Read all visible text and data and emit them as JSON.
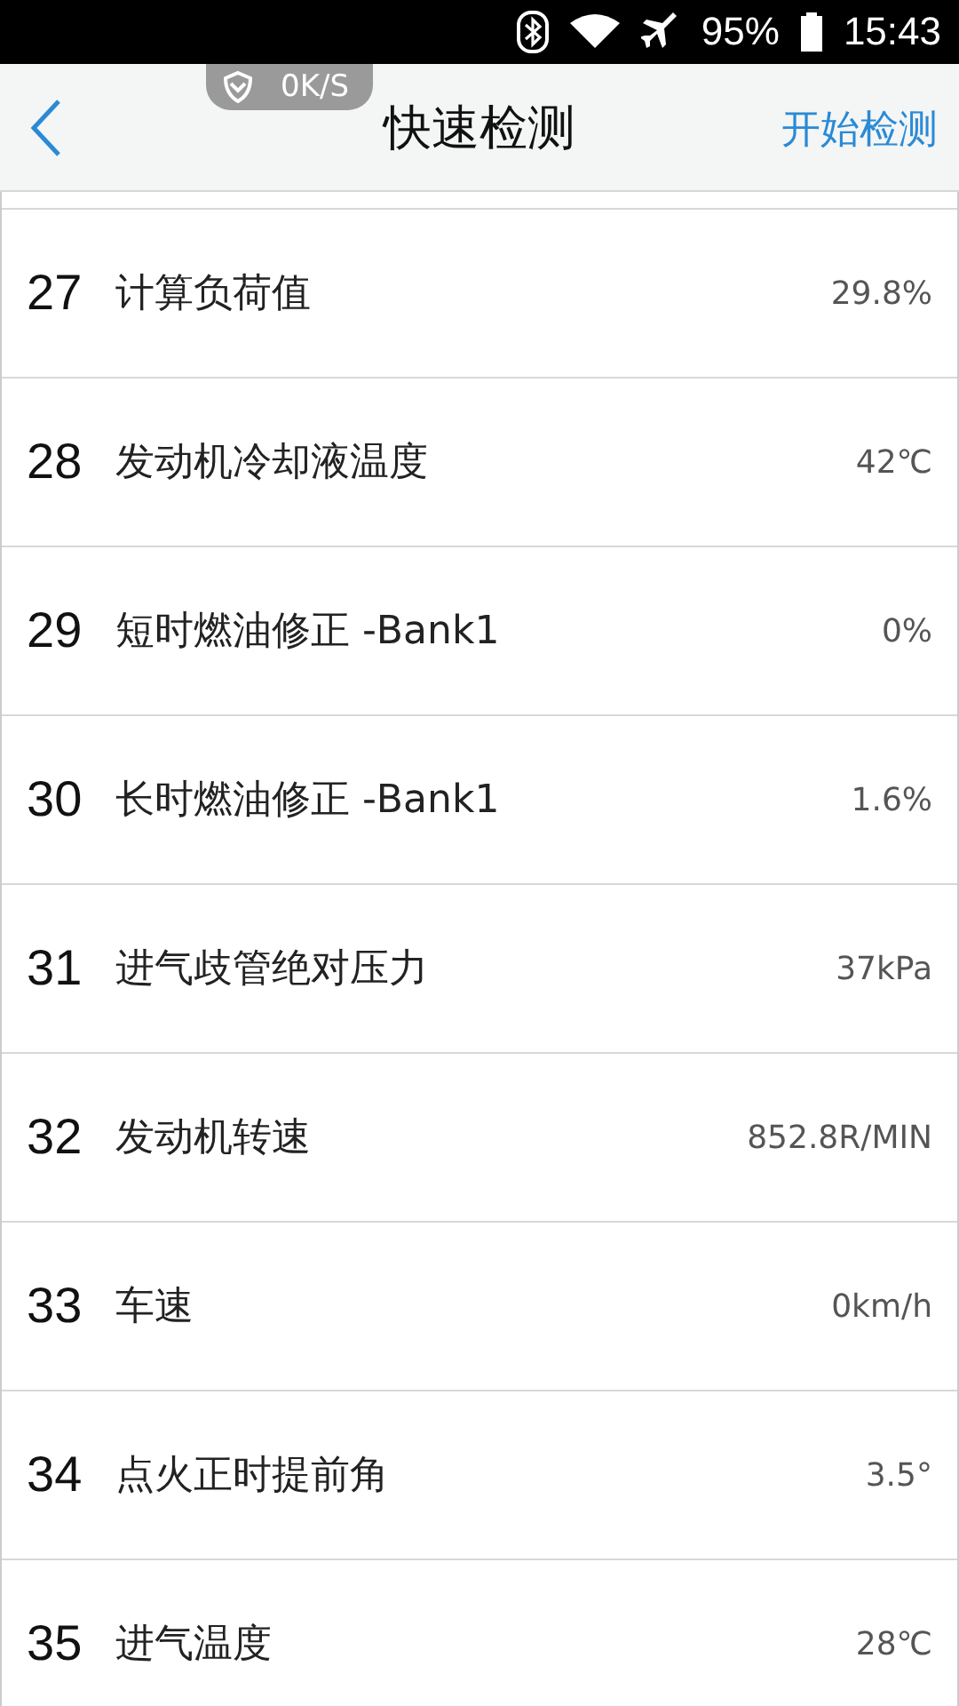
{
  "status_bar": {
    "battery": "95%",
    "time": "15:43"
  },
  "speed_badge": {
    "text": "0K/S"
  },
  "header": {
    "title": "快速检测",
    "action": "开始检测"
  },
  "rows": [
    {
      "number": "27",
      "name": "计算负荷值",
      "value": "29.8%"
    },
    {
      "number": "28",
      "name": "发动机冷却液温度",
      "value": "42℃"
    },
    {
      "number": "29",
      "name": "短时燃油修正 -Bank1",
      "value": "0%"
    },
    {
      "number": "30",
      "name": "长时燃油修正 -Bank1",
      "value": "1.6%"
    },
    {
      "number": "31",
      "name": "进气歧管绝对压力",
      "value": "37kPa"
    },
    {
      "number": "32",
      "name": "发动机转速",
      "value": "852.8R/MIN"
    },
    {
      "number": "33",
      "name": "车速",
      "value": "0km/h"
    },
    {
      "number": "34",
      "name": "点火正时提前角",
      "value": "3.5°"
    },
    {
      "number": "35",
      "name": "进气温度",
      "value": "28℃"
    }
  ]
}
